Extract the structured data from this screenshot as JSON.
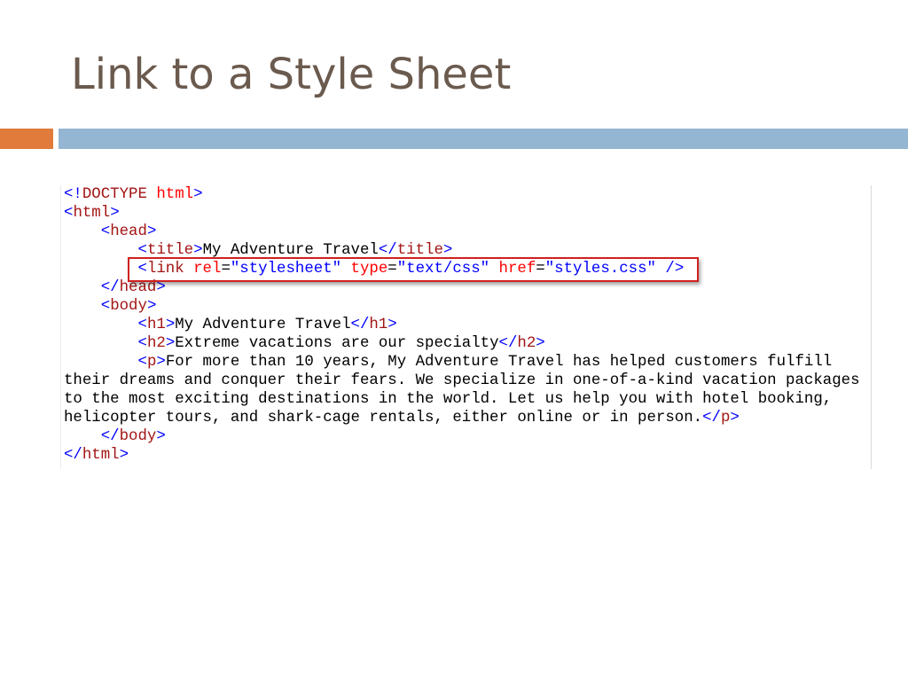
{
  "slide": {
    "title": "Link to a Style Sheet"
  },
  "accent_colors": {
    "orange": "#e07b3c",
    "blue": "#94b6d2",
    "highlight": "#d02020"
  },
  "code": {
    "highlighted_line": 5,
    "lines": [
      [
        {
          "t": "<!",
          "c": "ab"
        },
        {
          "t": "DOCTYPE",
          "c": "tg"
        },
        {
          "t": " ",
          "c": "pl"
        },
        {
          "t": "html",
          "c": "an"
        },
        {
          "t": ">",
          "c": "ab"
        }
      ],
      [
        {
          "t": "<",
          "c": "ab"
        },
        {
          "t": "html",
          "c": "tg"
        },
        {
          "t": ">",
          "c": "ab"
        }
      ],
      [
        {
          "t": "    ",
          "c": "pl"
        },
        {
          "t": "<",
          "c": "ab"
        },
        {
          "t": "head",
          "c": "tg"
        },
        {
          "t": ">",
          "c": "ab"
        }
      ],
      [
        {
          "t": "        ",
          "c": "pl"
        },
        {
          "t": "<",
          "c": "ab"
        },
        {
          "t": "title",
          "c": "tg"
        },
        {
          "t": ">",
          "c": "ab"
        },
        {
          "t": "My Adventure Travel",
          "c": "pl"
        },
        {
          "t": "</",
          "c": "ab"
        },
        {
          "t": "title",
          "c": "tg"
        },
        {
          "t": ">",
          "c": "ab"
        }
      ],
      [
        {
          "t": "        ",
          "c": "pl"
        },
        {
          "t": "<",
          "c": "ab"
        },
        {
          "t": "link",
          "c": "tg"
        },
        {
          "t": " ",
          "c": "pl"
        },
        {
          "t": "rel",
          "c": "an"
        },
        {
          "t": "=",
          "c": "pl"
        },
        {
          "t": "\"stylesheet\"",
          "c": "av"
        },
        {
          "t": " ",
          "c": "pl"
        },
        {
          "t": "type",
          "c": "an"
        },
        {
          "t": "=",
          "c": "pl"
        },
        {
          "t": "\"text/css\"",
          "c": "av"
        },
        {
          "t": " ",
          "c": "pl"
        },
        {
          "t": "href",
          "c": "an"
        },
        {
          "t": "=",
          "c": "pl"
        },
        {
          "t": "\"styles.css\"",
          "c": "av"
        },
        {
          "t": " />",
          "c": "ab"
        }
      ],
      [
        {
          "t": "    ",
          "c": "pl"
        },
        {
          "t": "</",
          "c": "ab"
        },
        {
          "t": "head",
          "c": "tg"
        },
        {
          "t": ">",
          "c": "ab"
        }
      ],
      [
        {
          "t": "    ",
          "c": "pl"
        },
        {
          "t": "<",
          "c": "ab"
        },
        {
          "t": "body",
          "c": "tg"
        },
        {
          "t": ">",
          "c": "ab"
        }
      ],
      [
        {
          "t": "        ",
          "c": "pl"
        },
        {
          "t": "<",
          "c": "ab"
        },
        {
          "t": "h1",
          "c": "tg"
        },
        {
          "t": ">",
          "c": "ab"
        },
        {
          "t": "My Adventure Travel",
          "c": "pl"
        },
        {
          "t": "</",
          "c": "ab"
        },
        {
          "t": "h1",
          "c": "tg"
        },
        {
          "t": ">",
          "c": "ab"
        }
      ],
      [
        {
          "t": "        ",
          "c": "pl"
        },
        {
          "t": "<",
          "c": "ab"
        },
        {
          "t": "h2",
          "c": "tg"
        },
        {
          "t": ">",
          "c": "ab"
        },
        {
          "t": "Extreme vacations are our specialty",
          "c": "pl"
        },
        {
          "t": "</",
          "c": "ab"
        },
        {
          "t": "h2",
          "c": "tg"
        },
        {
          "t": ">",
          "c": "ab"
        }
      ],
      [
        {
          "t": "        ",
          "c": "pl"
        },
        {
          "t": "<",
          "c": "ab"
        },
        {
          "t": "p",
          "c": "tg"
        },
        {
          "t": ">",
          "c": "ab"
        },
        {
          "t": "For more than 10 years, My Adventure Travel has helped customers fulfill",
          "c": "pl"
        }
      ],
      [
        {
          "t": "their dreams and conquer their fears. We specialize in one-of-a-kind vacation packages",
          "c": "pl"
        }
      ],
      [
        {
          "t": "to the most exciting destinations in the world. Let us help you with hotel booking,",
          "c": "pl"
        }
      ],
      [
        {
          "t": "helicopter tours, and shark-cage rentals, either online or in person.",
          "c": "pl"
        },
        {
          "t": "</",
          "c": "ab"
        },
        {
          "t": "p",
          "c": "tg"
        },
        {
          "t": ">",
          "c": "ab"
        }
      ],
      [
        {
          "t": "    ",
          "c": "pl"
        },
        {
          "t": "</",
          "c": "ab"
        },
        {
          "t": "body",
          "c": "tg"
        },
        {
          "t": ">",
          "c": "ab"
        }
      ],
      [
        {
          "t": "</",
          "c": "ab"
        },
        {
          "t": "html",
          "c": "tg"
        },
        {
          "t": ">",
          "c": "ab"
        }
      ]
    ]
  }
}
